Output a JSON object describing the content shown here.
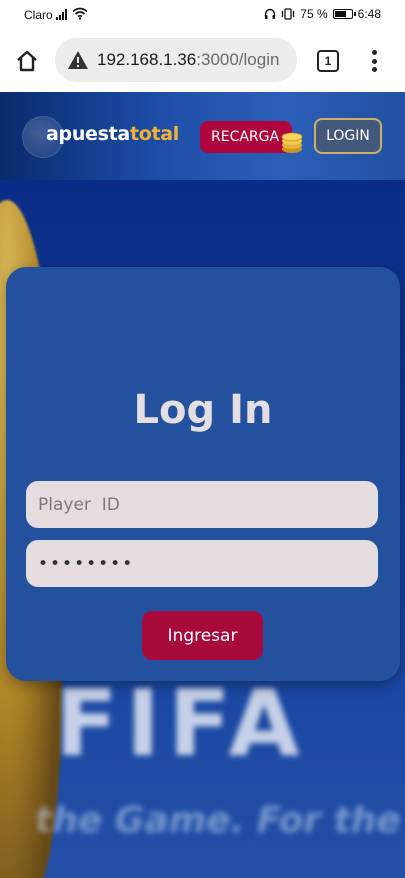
{
  "status_bar": {
    "carrier": "Claro",
    "battery": "75 %",
    "battery_level": 0.75,
    "time": "6:48"
  },
  "browser": {
    "url_host": "192.168.1.36",
    "url_path": ":3000/login",
    "tab_count": "1"
  },
  "header": {
    "logo_part1": "apuesta",
    "logo_part2": "total",
    "recarga_label": "RECARGA",
    "login_label": "LOGIN",
    "colors": {
      "brand_red": "#b0063e",
      "brand_gold": "#f2b134",
      "navy": "#23519d"
    }
  },
  "login": {
    "title": "Log In",
    "player_id_placeholder": "Player  ID",
    "password_value": "12345678",
    "submit_label": "Ingresar"
  },
  "background": {
    "fifa_text": "FIFA",
    "slogan_text": "the Game. For the"
  }
}
